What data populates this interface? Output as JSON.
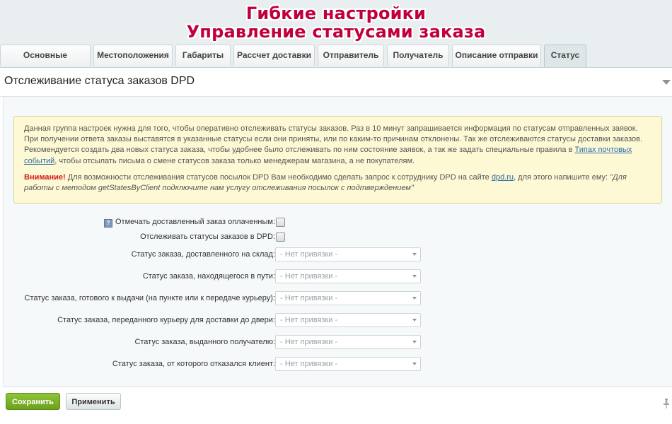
{
  "banner": {
    "line1": "Гибкие настройки",
    "line2": "Управление статусами заказа",
    "color": "#c0003c"
  },
  "tabs": [
    {
      "label": "Основные настройки",
      "active": false
    },
    {
      "label": "Местоположения",
      "active": false
    },
    {
      "label": "Габариты",
      "active": false
    },
    {
      "label": "Рассчет доставки",
      "active": false
    },
    {
      "label": "Отправитель",
      "active": false
    },
    {
      "label": "Получатель",
      "active": false
    },
    {
      "label": "Описание отправки",
      "active": false
    },
    {
      "label": "Статус",
      "active": true
    }
  ],
  "panel": {
    "title": "Отслеживание статуса заказов DPD"
  },
  "notice": {
    "para1_text": "Данная группа настроек нужна для того, чтобы оперативно отслеживать статусы заказов. Раз в 10 минут запрашивается информация по статусам отправленных заявок. При получении ответа заказы выставятся в указанные статусы если они приняты, или по каким-то причинам отклонены. Так же отслеживаются статусы доставки заказов. Рекомендуется создать два новых статуса заказа, чтобы удобнее было отслеживать по ним состояние заявок, а так же задать специальные правила в ",
    "para1_link": "Типах почтовых событий",
    "para1_tail": ", чтобы отсылать письма о смене статусов заказа только менеджерам магазина, а не покупателям.",
    "warn_label": "Внимание!",
    "para2_text": " Для возможности отслеживания статусов посылок DPD Вам необходимо сделать запрос к сотруднику DPD на сайте ",
    "para2_link": "dpd.ru",
    "para2_mid": ", для этого напишите ему: ",
    "para2_quote": "\"Для работы с методом getStatesByClient подключите нам услугу отслеживания посылок с подтверждением\""
  },
  "checkboxes": [
    {
      "label": "Отмечать доставленный заказ оплаченным:",
      "checked": false,
      "help": true
    },
    {
      "label": "Отслеживать статусы заказов в DPD:",
      "checked": false,
      "help": false
    }
  ],
  "selects": [
    {
      "label": "Статус заказа, доставленного на склад:",
      "value": "- Нет привязки -"
    },
    {
      "label": "Статус заказа, находящегося в пути:",
      "value": "- Нет привязки -"
    },
    {
      "label": "Статус заказа, готового к выдачи (на пункте или к передаче курьеру):",
      "value": "- Нет привязки -"
    },
    {
      "label": "Статус заказа, переданного курьеру для доставки до двери:",
      "value": "- Нет привязки -"
    },
    {
      "label": "Статус заказа, выданного получателю:",
      "value": "- Нет привязки -"
    },
    {
      "label": "Статус заказа, от которого отказался клиент:",
      "value": "- Нет привязки -"
    }
  ],
  "buttons": {
    "save": "Сохранить",
    "apply": "Применить"
  },
  "icons": {
    "help": "help-icon",
    "collapse": "triangle-down-icon",
    "pin": "pin-icon"
  },
  "colors": {
    "save_button": "#7db42a",
    "notice_bg": "#fef9d5",
    "warning": "#d01a1a",
    "link": "#2a6aa8"
  }
}
